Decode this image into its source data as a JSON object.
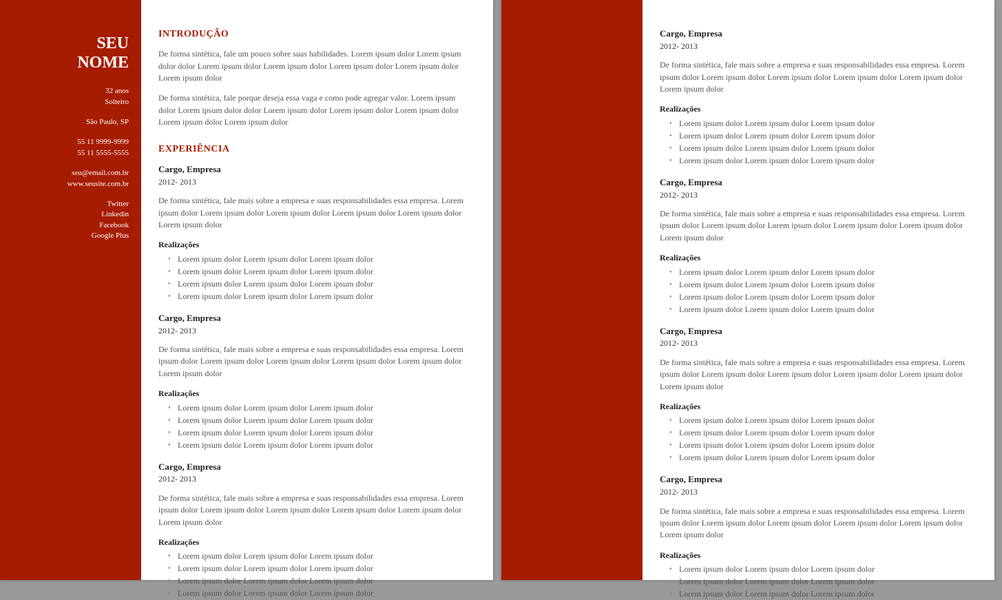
{
  "colors": {
    "accent": "#a61c00"
  },
  "sidebar": {
    "name_line1": "SEU",
    "name_line2": "NOME",
    "age": "32 anos",
    "marital": "Solteiro",
    "city": "São Paulo, SP",
    "phone1": "55 11 9999-9999",
    "phone2": "55 11  5555-5555",
    "email": "seu@email.com.br",
    "website": "www.seusite.com.br",
    "social": [
      "Twitter",
      "Linkedin",
      "Facebook",
      "Google Plus"
    ]
  },
  "headings": {
    "intro": "INTRODUÇÃO",
    "exp": "EXPERIÊNCIA",
    "achievements": "Realizações"
  },
  "intro": {
    "p1": "De forma sintética, fale um pouco sobre suas habilidades. Lorem ipsum dolor Lorem ipsum dolor dolor Lorem ipsum dolor Lorem ipsum dolor Lorem ipsum dolor Lorem ipsum dolor Lorem ipsum dolor",
    "p2": "De forma sintética, fale porque deseja essa vaga e como pode agregar valor. Lorem ipsum dolor Lorem ipsum dolor dolor Lorem ipsum dolor Lorem ipsum dolor Lorem ipsum dolor Lorem ipsum dolor Lorem ipsum dolor"
  },
  "jobs_p1": [
    {
      "title": "Cargo, Empresa",
      "dates": "2012- 2013",
      "desc": "De forma sintética, fale mais sobre a empresa e suas responsabilidades essa empresa. Lorem ipsum dolor Lorem ipsum dolor Lorem ipsum dolor Lorem ipsum dolor Lorem ipsum dolor Lorem ipsum dolor",
      "bullets": [
        "Lorem ipsum dolor Lorem ipsum dolor Lorem ipsum dolor",
        "Lorem ipsum dolor Lorem ipsum dolor Lorem ipsum dolor",
        "Lorem ipsum dolor Lorem ipsum dolor Lorem ipsum dolor",
        "Lorem ipsum dolor Lorem ipsum dolor Lorem ipsum dolor"
      ]
    },
    {
      "title": "Cargo, Empresa",
      "dates": "2012- 2013",
      "desc": "De forma sintética, fale mais sobre a empresa e suas responsabilidades essa empresa. Lorem ipsum dolor Lorem ipsum dolor Lorem ipsum dolor Lorem ipsum dolor Lorem ipsum dolor Lorem ipsum dolor",
      "bullets": [
        "Lorem ipsum dolor Lorem ipsum dolor Lorem ipsum dolor",
        "Lorem ipsum dolor Lorem ipsum dolor Lorem ipsum dolor",
        "Lorem ipsum dolor Lorem ipsum dolor Lorem ipsum dolor",
        "Lorem ipsum dolor Lorem ipsum dolor Lorem ipsum dolor"
      ]
    },
    {
      "title": "Cargo, Empresa",
      "dates": "2012- 2013",
      "desc": "De forma sintética, fale mais sobre a empresa e suas responsabilidades essa empresa. Lorem ipsum dolor Lorem ipsum dolor Lorem ipsum dolor Lorem ipsum dolor Lorem ipsum dolor Lorem ipsum dolor",
      "bullets": [
        "Lorem ipsum dolor Lorem ipsum dolor Lorem ipsum dolor",
        "Lorem ipsum dolor Lorem ipsum dolor Lorem ipsum dolor",
        "Lorem ipsum dolor Lorem ipsum dolor Lorem ipsum dolor",
        "Lorem ipsum dolor Lorem ipsum dolor Lorem ipsum dolor"
      ]
    }
  ],
  "jobs_p2": [
    {
      "title": "Cargo, Empresa",
      "dates": "2012- 2013",
      "desc": "De forma sintética, fale mais sobre a empresa e suas responsabilidades essa empresa. Lorem ipsum dolor Lorem ipsum dolor Lorem ipsum dolor Lorem ipsum dolor Lorem ipsum dolor Lorem ipsum dolor",
      "bullets": [
        "Lorem ipsum dolor Lorem ipsum dolor Lorem ipsum dolor",
        "Lorem ipsum dolor Lorem ipsum dolor Lorem ipsum dolor",
        "Lorem ipsum dolor Lorem ipsum dolor Lorem ipsum dolor",
        "Lorem ipsum dolor Lorem ipsum dolor Lorem ipsum dolor"
      ]
    },
    {
      "title": "Cargo, Empresa",
      "dates": "2012- 2013",
      "desc": "De forma sintética, fale mais sobre a empresa e suas responsabilidades essa empresa. Lorem ipsum dolor Lorem ipsum dolor Lorem ipsum dolor Lorem ipsum dolor Lorem ipsum dolor Lorem ipsum dolor",
      "bullets": [
        "Lorem ipsum dolor Lorem ipsum dolor Lorem ipsum dolor",
        "Lorem ipsum dolor Lorem ipsum dolor Lorem ipsum dolor",
        "Lorem ipsum dolor Lorem ipsum dolor Lorem ipsum dolor",
        "Lorem ipsum dolor Lorem ipsum dolor Lorem ipsum dolor"
      ]
    },
    {
      "title": "Cargo, Empresa",
      "dates": "2012- 2013",
      "desc": "De forma sintética, fale mais sobre a empresa e suas responsabilidades essa empresa. Lorem ipsum dolor Lorem ipsum dolor Lorem ipsum dolor Lorem ipsum dolor Lorem ipsum dolor Lorem ipsum dolor",
      "bullets": [
        "Lorem ipsum dolor Lorem ipsum dolor Lorem ipsum dolor",
        "Lorem ipsum dolor Lorem ipsum dolor Lorem ipsum dolor",
        "Lorem ipsum dolor Lorem ipsum dolor Lorem ipsum dolor",
        "Lorem ipsum dolor Lorem ipsum dolor Lorem ipsum dolor"
      ]
    },
    {
      "title": "Cargo, Empresa",
      "dates": "2012- 2013",
      "desc": "De forma sintética, fale mais sobre a empresa e suas responsabilidades essa empresa. Lorem ipsum dolor Lorem ipsum dolor Lorem ipsum dolor Lorem ipsum dolor Lorem ipsum dolor Lorem ipsum dolor",
      "bullets": [
        "Lorem ipsum dolor Lorem ipsum dolor Lorem ipsum dolor",
        "Lorem ipsum dolor Lorem ipsum dolor Lorem ipsum dolor",
        "Lorem ipsum dolor Lorem ipsum dolor Lorem ipsum dolor"
      ]
    }
  ]
}
